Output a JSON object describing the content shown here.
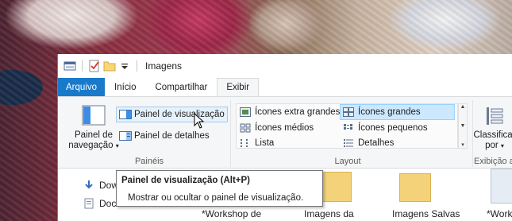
{
  "window": {
    "title": "Imagens"
  },
  "ribbon_tabs": [
    {
      "label": "Arquivo"
    },
    {
      "label": "Início"
    },
    {
      "label": "Compartilhar"
    },
    {
      "label": "Exibir"
    }
  ],
  "panes_group": {
    "label": "Painéis",
    "navigation_pane_line1": "Painel de",
    "navigation_pane_line2": "navegação",
    "preview_pane": "Painel de visualização",
    "details_pane": "Painel de detalhes"
  },
  "layout_group": {
    "label": "Layout",
    "options": [
      {
        "label": "Ícones extra grandes"
      },
      {
        "label": "Ícones grandes"
      },
      {
        "label": "Ícones médios"
      },
      {
        "label": "Ícones pequenos"
      },
      {
        "label": "Lista"
      },
      {
        "label": "Detalhes"
      }
    ]
  },
  "view_group": {
    "label": "Exibição a",
    "sort_line1": "Classificar",
    "sort_line2": "por"
  },
  "tooltip": {
    "title": "Painel de visualização (Alt+P)",
    "body": "Mostrar ou ocultar o painel de visualização."
  },
  "navigation": {
    "items": [
      {
        "label": "Dow"
      },
      {
        "label": "Doc"
      }
    ]
  },
  "files": [
    {
      "label": "*Workshop de"
    },
    {
      "label": "Imagens da"
    },
    {
      "label": "Imagens Salvas"
    },
    {
      "label": "*Work"
    }
  ],
  "colors": {
    "file_tab": "#1979ca",
    "selected": "#cce8ff",
    "hover": "#e5f1fb"
  }
}
